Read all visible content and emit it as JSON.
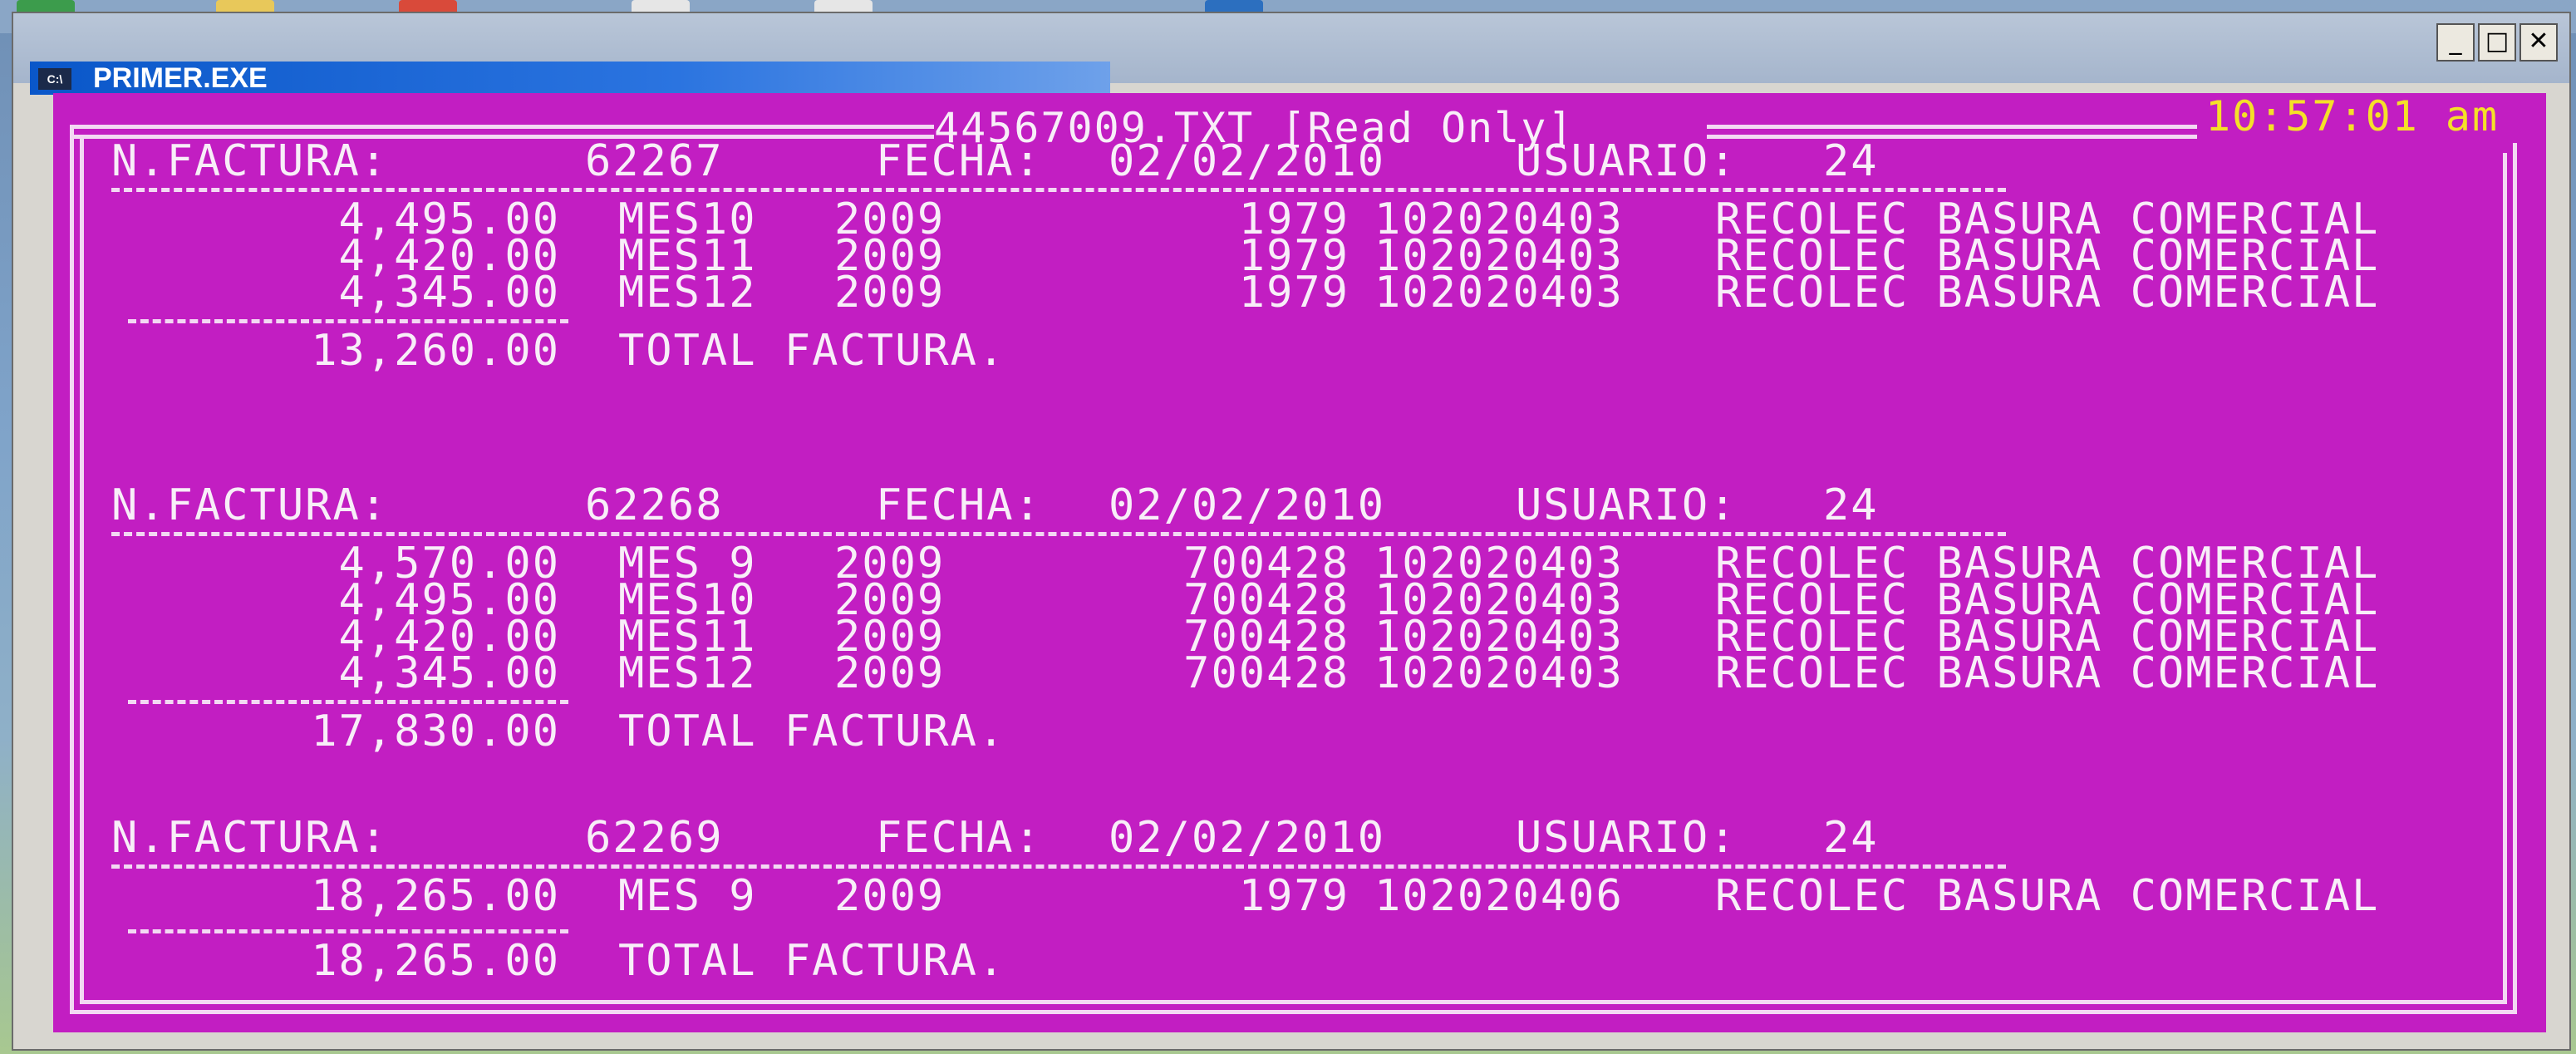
{
  "window": {
    "title": "PRIMER.EXE",
    "icon_label": "C:\\",
    "buttons": {
      "minimize": "_",
      "maximize": "□",
      "close": "✕"
    }
  },
  "console": {
    "file_title": "44567009.TXT [Read Only]",
    "clock": "10:57:01 am",
    "labels": {
      "invoice": "N.FACTURA:",
      "date": "FECHA:",
      "user": "USUARIO:",
      "total": "TOTAL FACTURA."
    },
    "invoices": [
      {
        "number": "62267",
        "date": "02/02/2010",
        "user": "24",
        "lines": [
          {
            "amount": "4,495.00",
            "month": "MES10",
            "year": "2009",
            "code": "1979",
            "account": "102020403",
            "concept": "RECOLEC BASURA COMERCIAL"
          },
          {
            "amount": "4,420.00",
            "month": "MES11",
            "year": "2009",
            "code": "1979",
            "account": "102020403",
            "concept": "RECOLEC BASURA COMERCIAL"
          },
          {
            "amount": "4,345.00",
            "month": "MES12",
            "year": "2009",
            "code": "1979",
            "account": "102020403",
            "concept": "RECOLEC BASURA COMERCIAL"
          }
        ],
        "total": "13,260.00"
      },
      {
        "number": "62268",
        "date": "02/02/2010",
        "user": "24",
        "lines": [
          {
            "amount": "4,570.00",
            "month": "MES 9",
            "year": "2009",
            "code": "700428",
            "account": "102020403",
            "concept": "RECOLEC BASURA COMERCIAL"
          },
          {
            "amount": "4,495.00",
            "month": "MES10",
            "year": "2009",
            "code": "700428",
            "account": "102020403",
            "concept": "RECOLEC BASURA COMERCIAL"
          },
          {
            "amount": "4,420.00",
            "month": "MES11",
            "year": "2009",
            "code": "700428",
            "account": "102020403",
            "concept": "RECOLEC BASURA COMERCIAL"
          },
          {
            "amount": "4,345.00",
            "month": "MES12",
            "year": "2009",
            "code": "700428",
            "account": "102020403",
            "concept": "RECOLEC BASURA COMERCIAL"
          }
        ],
        "total": "17,830.00"
      },
      {
        "number": "62269",
        "date": "02/02/2010",
        "user": "24",
        "lines": [
          {
            "amount": "18,265.00",
            "month": "MES 9",
            "year": "2009",
            "code": "1979",
            "account": "102020406",
            "concept": "RECOLEC BASURA COMERCIAL"
          }
        ],
        "total": "18,265.00"
      }
    ]
  },
  "colors": {
    "console_bg": "#c21ec2",
    "console_text": "#f8eef8",
    "clock": "#f5e028",
    "titlebar": "#0a57c9"
  }
}
